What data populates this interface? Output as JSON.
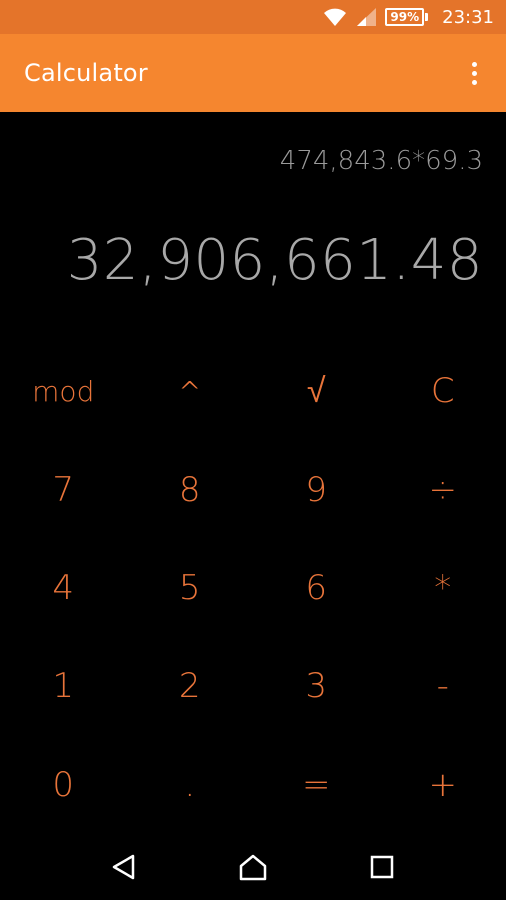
{
  "status_bar": {
    "battery": "99%",
    "time": "23:31"
  },
  "app_bar": {
    "title": "Calculator"
  },
  "display": {
    "expression": "474,843.6*69.3",
    "result": "32,906,661.48"
  },
  "keypad": {
    "keys": [
      {
        "label": "mod",
        "name": "mod-key"
      },
      {
        "label": "^",
        "name": "power-key"
      },
      {
        "label": "√",
        "name": "sqrt-key"
      },
      {
        "label": "C",
        "name": "clear-key"
      },
      {
        "label": "7",
        "name": "digit-7-key"
      },
      {
        "label": "8",
        "name": "digit-8-key"
      },
      {
        "label": "9",
        "name": "digit-9-key"
      },
      {
        "label": "÷",
        "name": "divide-key"
      },
      {
        "label": "4",
        "name": "digit-4-key"
      },
      {
        "label": "5",
        "name": "digit-5-key"
      },
      {
        "label": "6",
        "name": "digit-6-key"
      },
      {
        "label": "*",
        "name": "multiply-key"
      },
      {
        "label": "1",
        "name": "digit-1-key"
      },
      {
        "label": "2",
        "name": "digit-2-key"
      },
      {
        "label": "3",
        "name": "digit-3-key"
      },
      {
        "label": "-",
        "name": "subtract-key"
      },
      {
        "label": "0",
        "name": "digit-0-key"
      },
      {
        "label": ".",
        "name": "decimal-key"
      },
      {
        "label": "=",
        "name": "equals-key"
      },
      {
        "label": "+",
        "name": "add-key"
      }
    ]
  },
  "colors": {
    "status_bar": "#e4742a",
    "app_bar": "#f5862f",
    "key_text": "#e8743a",
    "display_text": "#a8a8a8"
  },
  "icons": {
    "wifi": "wifi-icon",
    "signal": "cell-signal-icon",
    "battery": "battery-icon",
    "overflow": "more-vert-icon",
    "back": "back-triangle-icon",
    "home": "home-icon",
    "recents": "recents-square-icon"
  }
}
